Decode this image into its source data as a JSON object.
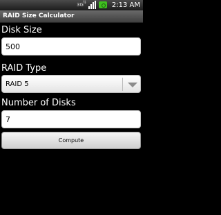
{
  "status_bar": {
    "network_label": "3G",
    "network_icon": "3g-data-icon",
    "signal_icon": "signal-strength-icon",
    "battery_icon": "battery-charging-icon",
    "time": "2:13 AM"
  },
  "app": {
    "title": "RAID Size Calculator"
  },
  "form": {
    "disk_size_label": "Disk Size",
    "disk_size_value": "500",
    "raid_type_label": "RAID Type",
    "raid_type_selected": "RAID 5",
    "num_disks_label": "Number of Disks",
    "num_disks_value": "7",
    "compute_label": "Compute"
  },
  "colors": {
    "background": "#000000",
    "battery": "#3fbf1f"
  }
}
